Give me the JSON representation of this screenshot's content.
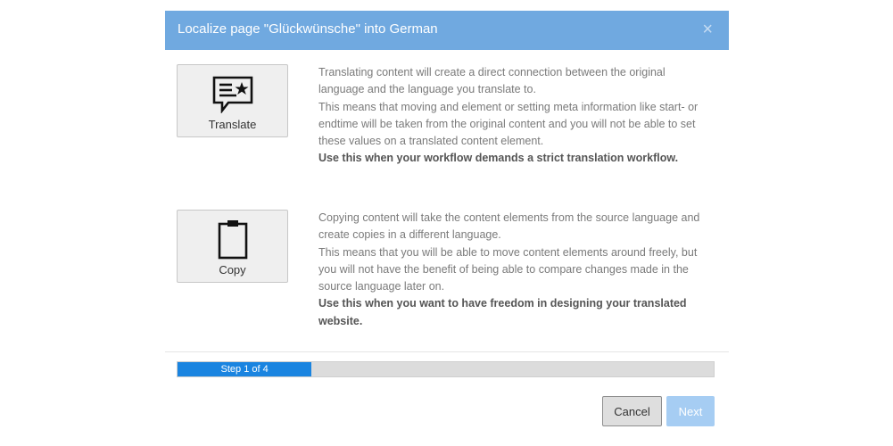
{
  "dialog": {
    "title": "Localize page \"Glückwünsche\" into German",
    "close_label": "×"
  },
  "options": [
    {
      "label": "Translate",
      "icon": "speech-bubble-star-icon",
      "description": [
        "Translating content will create a direct connection between the original language and the language you translate to.",
        "This means that moving and element or setting meta information like start- or endtime will be taken from the original content and you will not be able to set these values on a translated content element."
      ],
      "emphasis": "Use this when your workflow demands a strict translation workflow."
    },
    {
      "label": "Copy",
      "icon": "clipboard-icon",
      "description": [
        "Copying content will take the content elements from the source language and create copies in a different language.",
        "This means that you will be able to move content elements around freely, but you will not have the benefit of being able to compare changes made in the source language later on."
      ],
      "emphasis": "Use this when you want to have freedom in designing your translated website."
    }
  ],
  "progress": {
    "label": "Step 1 of 4",
    "current_step": 1,
    "total_steps": 4
  },
  "buttons": {
    "cancel": "Cancel",
    "next": "Next"
  },
  "colors": {
    "header": "#70a9e0",
    "progress_fill": "#1a84e0",
    "next_disabled": "#a6cdf3"
  }
}
